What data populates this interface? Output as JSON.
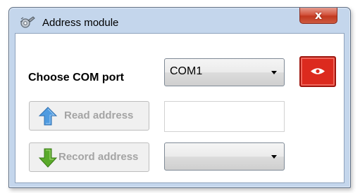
{
  "window": {
    "title": "Address module",
    "close_label": "x",
    "app_icon": "gear-wrench-icon"
  },
  "form": {
    "com_label": "Choose COM port",
    "com_selected": "COM1",
    "record_selected": "",
    "address_value": ""
  },
  "buttons": {
    "connect_icon": "eye-icon",
    "read_label": "Read address",
    "read_icon": "arrow-up-icon",
    "record_label": "Record address",
    "record_icon": "arrow-down-icon"
  },
  "colors": {
    "connect_button": "#dc2a1e",
    "read_arrow": "#4f9be0",
    "record_arrow": "#5aaa2a",
    "disabled_text": "#a4a4a4"
  }
}
